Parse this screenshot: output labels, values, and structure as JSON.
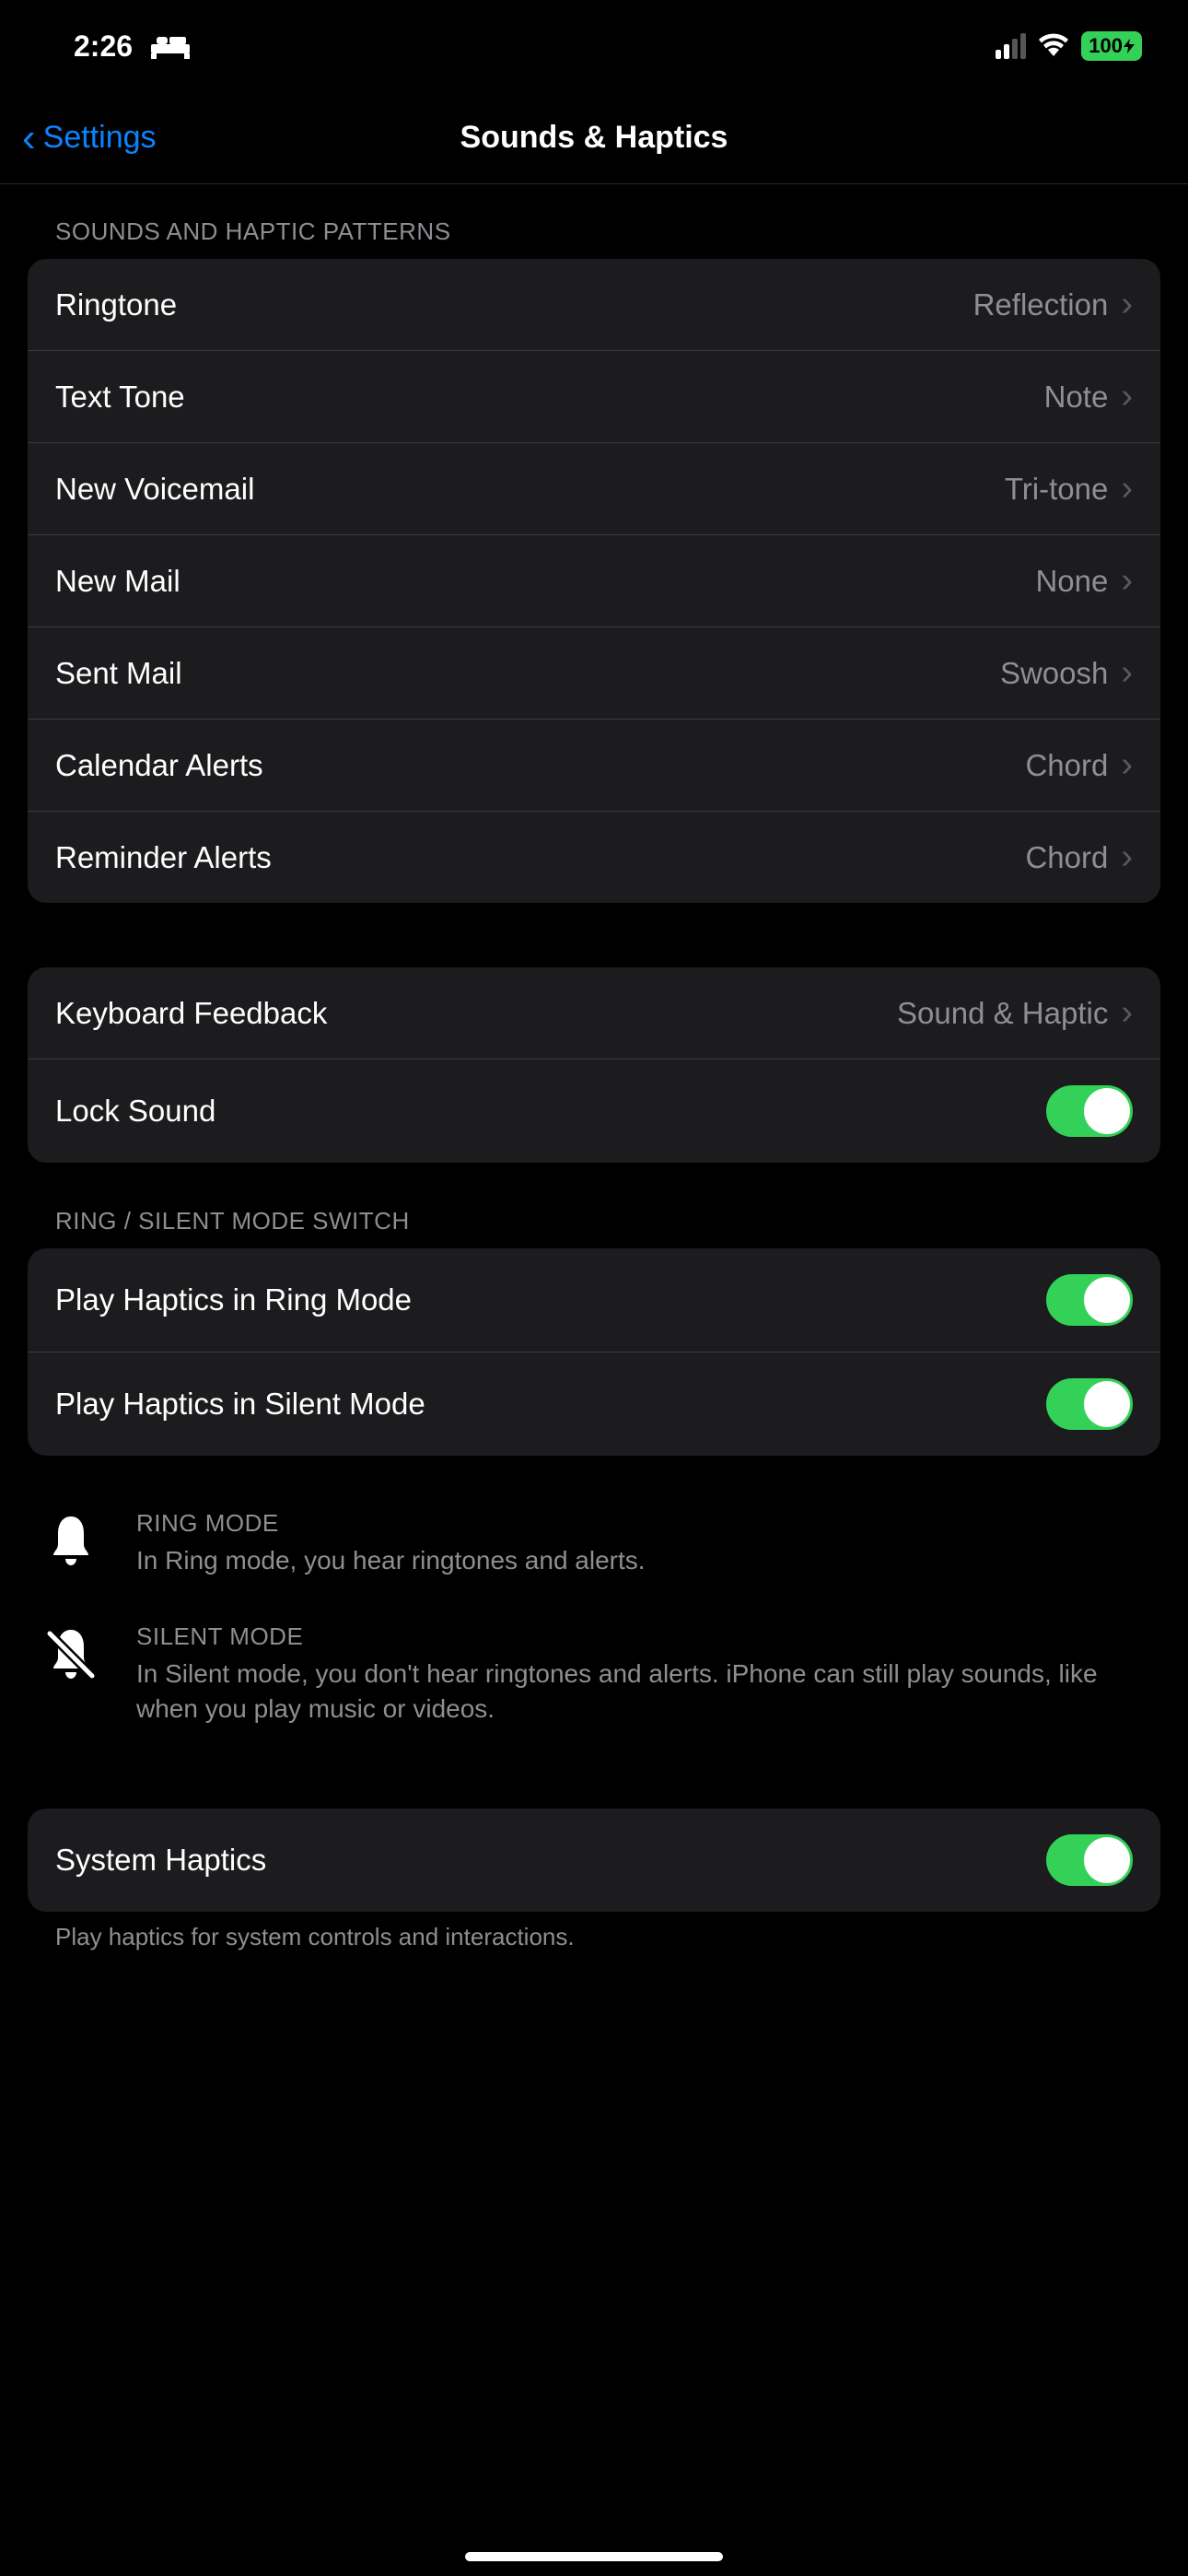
{
  "status": {
    "time": "2:26",
    "battery": "100"
  },
  "nav": {
    "back": "Settings",
    "title": "Sounds & Haptics"
  },
  "sections": {
    "patterns": {
      "header": "SOUNDS AND HAPTIC PATTERNS",
      "rows": {
        "ringtone": {
          "label": "Ringtone",
          "value": "Reflection"
        },
        "textTone": {
          "label": "Text Tone",
          "value": "Note"
        },
        "voicemail": {
          "label": "New Voicemail",
          "value": "Tri-tone"
        },
        "newMail": {
          "label": "New Mail",
          "value": "None"
        },
        "sentMail": {
          "label": "Sent Mail",
          "value": "Swoosh"
        },
        "calendar": {
          "label": "Calendar Alerts",
          "value": "Chord"
        },
        "reminder": {
          "label": "Reminder Alerts",
          "value": "Chord"
        }
      }
    },
    "feedback": {
      "keyboard": {
        "label": "Keyboard Feedback",
        "value": "Sound & Haptic"
      },
      "lock": {
        "label": "Lock Sound",
        "on": true
      }
    },
    "ringSilent": {
      "header": "RING / SILENT MODE SWITCH",
      "ringHaptics": {
        "label": "Play Haptics in Ring Mode",
        "on": true
      },
      "silentHaptics": {
        "label": "Play Haptics in Silent Mode",
        "on": true
      }
    },
    "modeInfo": {
      "ring": {
        "title": "RING MODE",
        "desc": "In Ring mode, you hear ringtones and alerts."
      },
      "silent": {
        "title": "SILENT MODE",
        "desc": "In Silent mode, you don't hear ringtones and alerts. iPhone can still play sounds, like when you play music or videos."
      }
    },
    "system": {
      "label": "System Haptics",
      "on": true,
      "footer": "Play haptics for system controls and interactions."
    }
  }
}
